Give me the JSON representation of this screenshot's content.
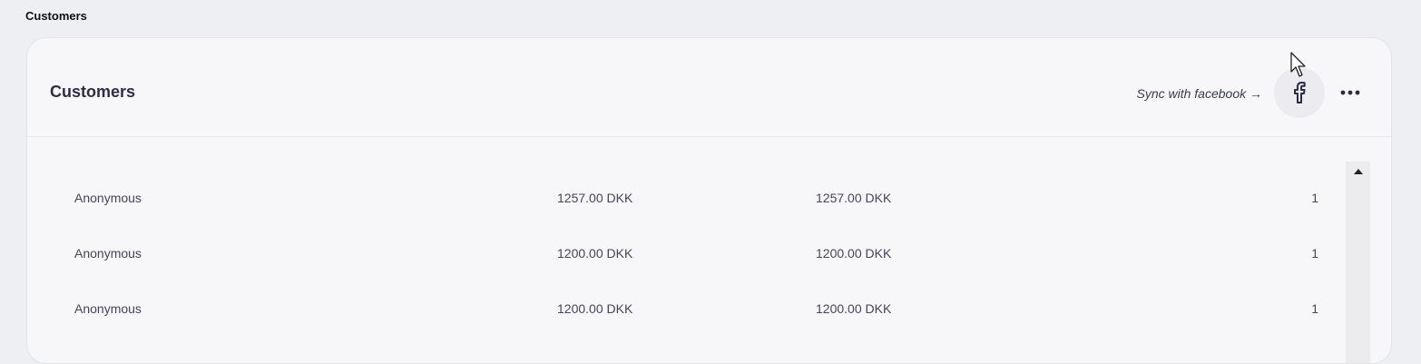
{
  "page": {
    "title": "Customers"
  },
  "card": {
    "title": "Customers",
    "sync_label": "Sync with facebook →"
  },
  "icons": {
    "facebook": "facebook-icon",
    "more": "more-dots-icon",
    "scroll_up": "arrow-up-icon"
  },
  "rows": [
    {
      "name": "Anonymous",
      "amount_a": "1257.00 DKK",
      "amount_b": "1257.00 DKK",
      "count": "1"
    },
    {
      "name": "Anonymous",
      "amount_a": "1200.00 DKK",
      "amount_b": "1200.00 DKK",
      "count": "1"
    },
    {
      "name": "Anonymous",
      "amount_a": "1200.00 DKK",
      "amount_b": "1200.00 DKK",
      "count": "1"
    }
  ]
}
